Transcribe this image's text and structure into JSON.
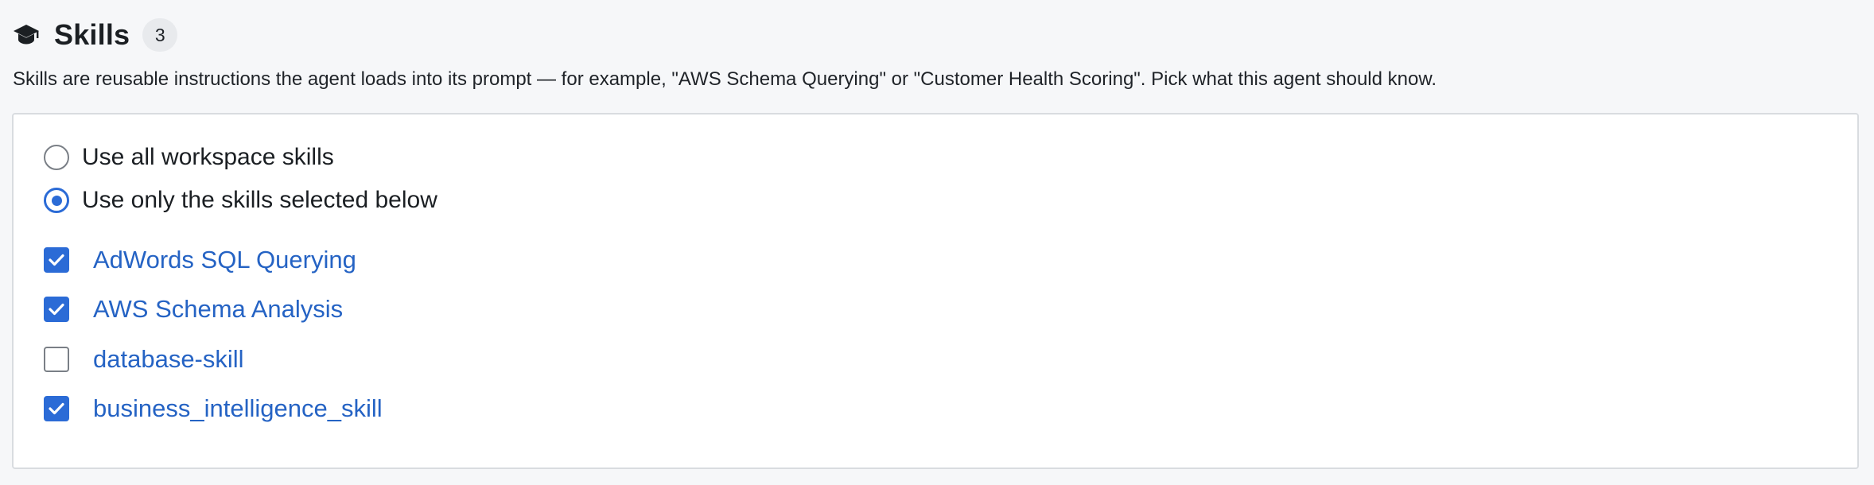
{
  "section": {
    "title": "Skills",
    "count": "3",
    "icon": "graduation-cap-icon",
    "description": "Skills are reusable instructions the agent loads into its prompt — for example, \"AWS Schema Querying\" or \"Customer Health Scoring\". Pick what this agent should know."
  },
  "mode": {
    "options": [
      {
        "label": "Use all workspace skills",
        "selected": false
      },
      {
        "label": "Use only the skills selected below",
        "selected": true
      }
    ]
  },
  "skills": [
    {
      "label": "AdWords SQL Querying",
      "checked": true
    },
    {
      "label": "AWS Schema Analysis",
      "checked": true
    },
    {
      "label": "database-skill",
      "checked": false
    },
    {
      "label": "business_intelligence_skill",
      "checked": true
    }
  ],
  "colors": {
    "accent": "#2b6bd6",
    "link": "#2563c4",
    "background": "#f6f7f9",
    "panel": "#ffffff"
  }
}
